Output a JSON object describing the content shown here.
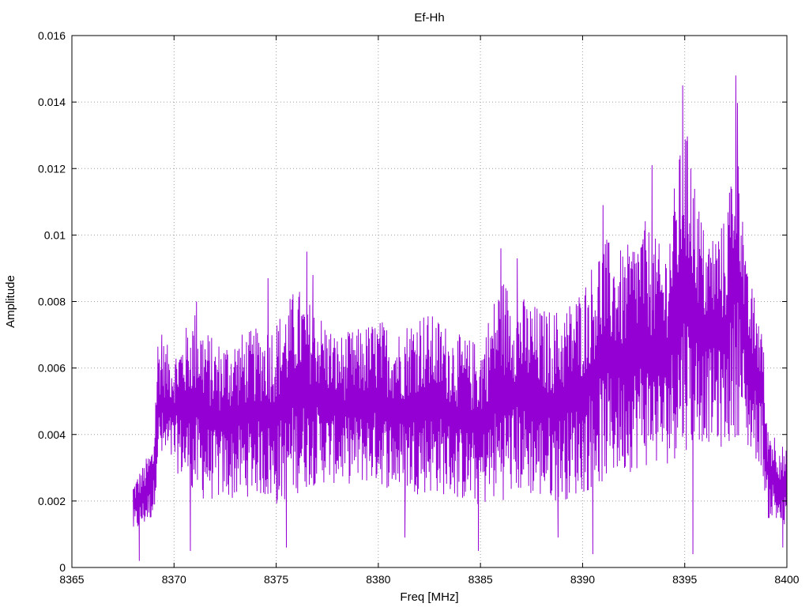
{
  "chart_data": {
    "type": "line",
    "title": "Ef-Hh",
    "xlabel": "Freq [MHz]",
    "ylabel": "Amplitude",
    "xlim": [
      8365,
      8400
    ],
    "ylim": [
      0,
      0.016
    ],
    "xticks": [
      "8365",
      "8370",
      "8375",
      "8380",
      "8385",
      "8390",
      "8395",
      "8400"
    ],
    "yticks": [
      "0",
      "0.002",
      "0.004",
      "0.006",
      "0.008",
      "0.01",
      "0.012",
      "0.014",
      "0.016"
    ],
    "grid": true,
    "legend": "none",
    "series": [
      {
        "color": "#9400d3",
        "x_start": 8368.0,
        "x_end": 8400.0,
        "envelope": [
          {
            "x": 8368.0,
            "low": 0.001,
            "high": 0.0026
          },
          {
            "x": 8368.5,
            "low": 0.0012,
            "high": 0.0031
          },
          {
            "x": 8369.0,
            "low": 0.0015,
            "high": 0.0038
          },
          {
            "x": 8369.2,
            "low": 0.003,
            "high": 0.007
          },
          {
            "x": 8370.0,
            "low": 0.003,
            "high": 0.0065
          },
          {
            "x": 8371.0,
            "low": 0.002,
            "high": 0.0078
          },
          {
            "x": 8372.0,
            "low": 0.002,
            "high": 0.0068
          },
          {
            "x": 8373.0,
            "low": 0.002,
            "high": 0.007
          },
          {
            "x": 8374.0,
            "low": 0.0022,
            "high": 0.0072
          },
          {
            "x": 8375.0,
            "low": 0.0018,
            "high": 0.0075
          },
          {
            "x": 8376.0,
            "low": 0.0022,
            "high": 0.0085
          },
          {
            "x": 8377.0,
            "low": 0.0025,
            "high": 0.0078
          },
          {
            "x": 8378.0,
            "low": 0.0025,
            "high": 0.007
          },
          {
            "x": 8379.0,
            "low": 0.0025,
            "high": 0.0072
          },
          {
            "x": 8380.0,
            "low": 0.0025,
            "high": 0.0075
          },
          {
            "x": 8381.0,
            "low": 0.0022,
            "high": 0.0072
          },
          {
            "x": 8382.0,
            "low": 0.0022,
            "high": 0.0078
          },
          {
            "x": 8383.0,
            "low": 0.0022,
            "high": 0.0075
          },
          {
            "x": 8384.0,
            "low": 0.002,
            "high": 0.007
          },
          {
            "x": 8385.0,
            "low": 0.0018,
            "high": 0.0068
          },
          {
            "x": 8386.0,
            "low": 0.002,
            "high": 0.0088
          },
          {
            "x": 8387.0,
            "low": 0.0022,
            "high": 0.0082
          },
          {
            "x": 8388.0,
            "low": 0.002,
            "high": 0.0078
          },
          {
            "x": 8389.0,
            "low": 0.002,
            "high": 0.0078
          },
          {
            "x": 8390.0,
            "low": 0.0022,
            "high": 0.0085
          },
          {
            "x": 8391.0,
            "low": 0.0025,
            "high": 0.01
          },
          {
            "x": 8392.0,
            "low": 0.0028,
            "high": 0.0095
          },
          {
            "x": 8393.0,
            "low": 0.003,
            "high": 0.0105
          },
          {
            "x": 8394.0,
            "low": 0.003,
            "high": 0.0095
          },
          {
            "x": 8395.0,
            "low": 0.0035,
            "high": 0.0135
          },
          {
            "x": 8396.0,
            "low": 0.0038,
            "high": 0.01
          },
          {
            "x": 8397.0,
            "low": 0.0035,
            "high": 0.0105
          },
          {
            "x": 8397.6,
            "low": 0.004,
            "high": 0.0145
          },
          {
            "x": 8398.0,
            "low": 0.0035,
            "high": 0.009
          },
          {
            "x": 8398.8,
            "low": 0.003,
            "high": 0.0075
          },
          {
            "x": 8399.0,
            "low": 0.0015,
            "high": 0.0045
          },
          {
            "x": 8400.0,
            "low": 0.001,
            "high": 0.0035
          }
        ],
        "spikes": [
          {
            "x": 8368.3,
            "y": 0.0002
          },
          {
            "x": 8369.4,
            "y": 0.007
          },
          {
            "x": 8370.8,
            "y": 0.0005
          },
          {
            "x": 8371.1,
            "y": 0.008
          },
          {
            "x": 8374.6,
            "y": 0.0087
          },
          {
            "x": 8375.5,
            "y": 0.0006
          },
          {
            "x": 8376.5,
            "y": 0.0095
          },
          {
            "x": 8376.8,
            "y": 0.0088
          },
          {
            "x": 8381.3,
            "y": 0.0009
          },
          {
            "x": 8384.9,
            "y": 0.0005
          },
          {
            "x": 8386.0,
            "y": 0.0096
          },
          {
            "x": 8386.8,
            "y": 0.0093
          },
          {
            "x": 8388.8,
            "y": 0.0009
          },
          {
            "x": 8390.5,
            "y": 0.0004
          },
          {
            "x": 8391.0,
            "y": 0.0109
          },
          {
            "x": 8393.4,
            "y": 0.0121
          },
          {
            "x": 8394.9,
            "y": 0.0145
          },
          {
            "x": 8395.3,
            "y": 0.012
          },
          {
            "x": 8395.4,
            "y": 0.0004
          },
          {
            "x": 8397.5,
            "y": 0.0148
          },
          {
            "x": 8399.8,
            "y": 0.0006
          }
        ]
      }
    ]
  }
}
